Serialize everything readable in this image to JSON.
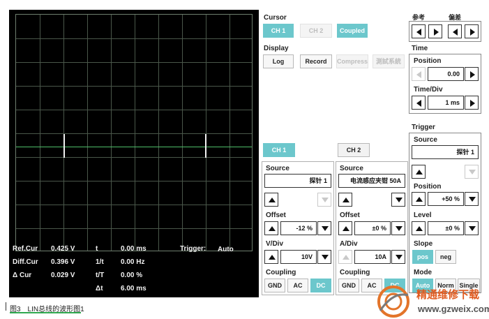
{
  "readouts": {
    "ref_cur_label": "Ref.Cur",
    "ref_cur_value": "0.425 V",
    "diff_cur_label": "Diff.Cur",
    "diff_cur_value": "0.396 V",
    "delta_cur_label": "Δ Cur",
    "delta_cur_value": "0.029 V",
    "t_label": "t",
    "t_value": "0.00 ms",
    "inv_t_label": "1/t",
    "inv_t_value": "0.00 Hz",
    "t_over_T_label": "t/T",
    "t_over_T_value": "0.00 %",
    "delta_t_label": "Δt",
    "delta_t_value": "6.00 ms",
    "trigger_label": "Trigger:",
    "trigger_value": "Auto"
  },
  "cursor": {
    "title": "Cursor",
    "ch1": "CH 1",
    "ch2": "CH 2",
    "coupled": "Coupled"
  },
  "display": {
    "title": "Display",
    "log": "Log",
    "record": "Record",
    "compress": "Compress",
    "test_system": "測試系統"
  },
  "ref_diff": {
    "ref_label": "参考",
    "diff_label": "偏差"
  },
  "time": {
    "title": "Time",
    "position_label": "Position",
    "position_value": "0.00",
    "div_label": "Time/Div",
    "div_value": "1 ms"
  },
  "ch1": {
    "tab": "CH 1",
    "source_label": "Source",
    "source_value": "探针 1",
    "offset_label": "Offset",
    "offset_value": "-12 %",
    "vdiv_label": "V/Div",
    "vdiv_value": "10V",
    "coupling_label": "Coupling",
    "gnd": "GND",
    "ac": "AC",
    "dc": "DC"
  },
  "ch2": {
    "tab": "CH 2",
    "source_label": "Source",
    "source_value": "电流感应夹钳 50A",
    "offset_label": "Offset",
    "offset_value": "±0 %",
    "adiv_label": "A/Div",
    "adiv_value": "10A",
    "coupling_label": "Coupling",
    "gnd": "GND",
    "ac": "AC",
    "dc": "DC"
  },
  "trigger": {
    "title": "Trigger",
    "source_label": "Source",
    "source_value": "探针 1",
    "position_label": "Position",
    "position_value": "+50 %",
    "level_label": "Level",
    "level_value": "±0 %",
    "slope_label": "Slope",
    "pos": "pos",
    "neg": "neg",
    "mode_label": "Mode",
    "auto": "Auto",
    "norm": "Norm",
    "single": "Single"
  },
  "caption": "图3　LIN总线的波形图1",
  "watermark": {
    "title": "精通维修下载",
    "url": "www.gzweix.com"
  },
  "colors": {
    "accent": "#6cc7cc",
    "trace": "#4fc06a",
    "scope_bg": "#000000"
  }
}
